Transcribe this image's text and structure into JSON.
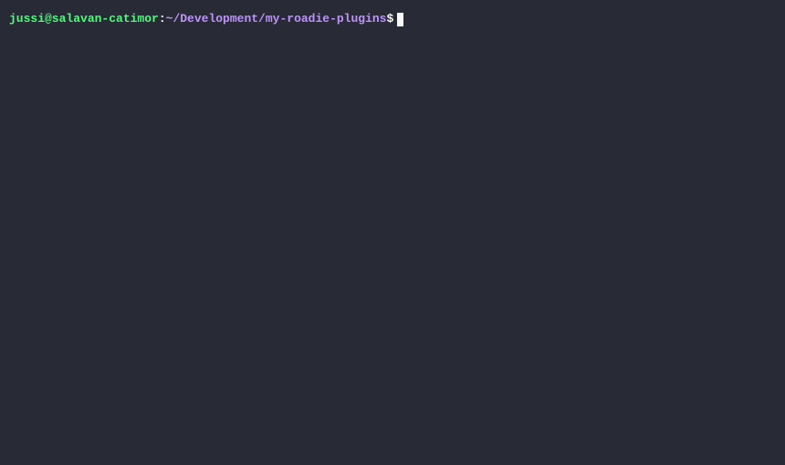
{
  "prompt": {
    "user_host": "jussi@salavan-catimor",
    "colon": ":",
    "path": "~/Development/my-roadie-plugins",
    "dollar": "$"
  },
  "command": ""
}
